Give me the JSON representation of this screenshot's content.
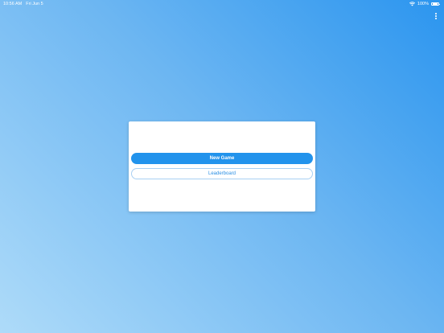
{
  "status_bar": {
    "time": "10:56 AM",
    "date": "Fri Jun 5",
    "battery_percent": "100%"
  },
  "menu": {
    "icon": "more-vertical-icon"
  },
  "dialog": {
    "new_game_label": "New Game",
    "leaderboard_label": "Leaderboard"
  },
  "colors": {
    "primary": "#2293ec",
    "background_top_right": "#2b95ef",
    "background_bottom_left": "#aedbf9"
  }
}
